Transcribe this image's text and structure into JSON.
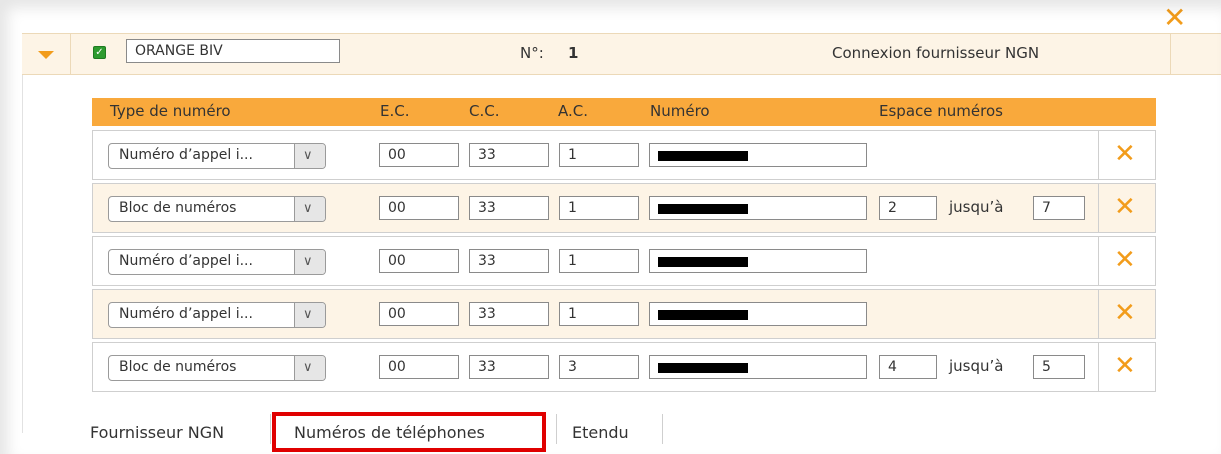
{
  "provider": {
    "checked": true,
    "name": "ORANGE BIV",
    "number_label": "N°:",
    "number_value": "1",
    "connection_label": "Connexion fournisseur NGN",
    "close_glyph": "✕",
    "check_glyph": "✓"
  },
  "table": {
    "headers": {
      "type": "Type de numéro",
      "ec": "E.C.",
      "cc": "C.C.",
      "ac": "A.C.",
      "numero": "Numéro",
      "espace": "Espace numéros"
    },
    "rows": [
      {
        "type": "Numéro d’appel i...",
        "ec": "00",
        "cc": "33",
        "ac": "1",
        "numero": "",
        "range_from": "",
        "range_to": "",
        "range_label": ""
      },
      {
        "type": "Bloc de numéros",
        "ec": "00",
        "cc": "33",
        "ac": "1",
        "numero": "",
        "range_from": "2",
        "range_to": "7",
        "range_label": "jusqu’à"
      },
      {
        "type": "Numéro d’appel i...",
        "ec": "00",
        "cc": "33",
        "ac": "1",
        "numero": "",
        "range_from": "",
        "range_to": "",
        "range_label": ""
      },
      {
        "type": "Numéro d’appel i...",
        "ec": "00",
        "cc": "33",
        "ac": "1",
        "numero": "",
        "range_from": "",
        "range_to": "",
        "range_label": ""
      },
      {
        "type": "Bloc de numéros",
        "ec": "00",
        "cc": "33",
        "ac": "3",
        "numero": "",
        "range_from": "4",
        "range_to": "5",
        "range_label": "jusqu’à"
      }
    ],
    "delete_glyph": "✕",
    "dropdown_glyph": "∨"
  },
  "tabs": [
    "Fournisseur NGN",
    "Numéros de téléphones",
    "Etendu"
  ],
  "colors": {
    "accent": "#f29c1b",
    "header_bg": "#f9a93c",
    "alt_row_bg": "#fdf4e6",
    "highlight": "#e00000"
  }
}
